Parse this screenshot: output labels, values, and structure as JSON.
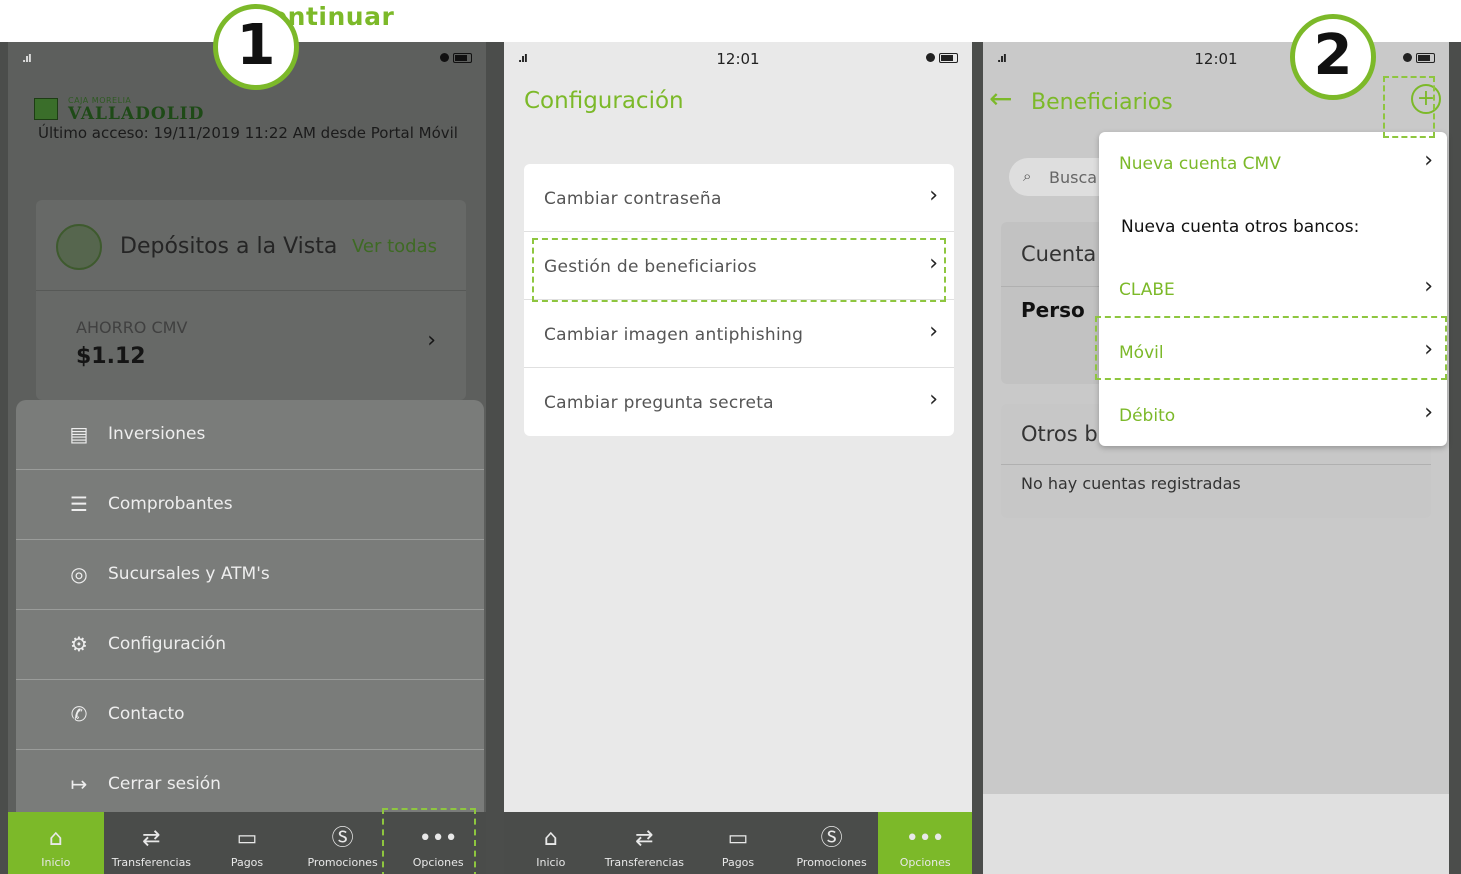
{
  "header_text": "ontinuar",
  "steps": [
    "1",
    "2"
  ],
  "colors": {
    "accent": "#7cb929",
    "nav_bg": "#4a4c4a",
    "screen_bg": "#e9e9e9"
  },
  "panel1": {
    "bank_name_top": "CAJA MORELIA",
    "bank_name": "VALLADOLID",
    "last_access": "Último acceso: 19/11/2019 11:22 AM desde Portal Móvil",
    "account_section_title": "Depósitos a la Vista",
    "view_all": "Ver todas",
    "account_name": "AHORRO CMV",
    "account_balance": "$1.12",
    "menu": [
      {
        "icon": "document-icon",
        "label": "Inversiones"
      },
      {
        "icon": "receipt-icon",
        "label": "Comprobantes"
      },
      {
        "icon": "location-pin-icon",
        "label": "Sucursales y ATM's"
      },
      {
        "icon": "gear-icon",
        "label": "Configuración"
      },
      {
        "icon": "phone-icon",
        "label": "Contacto"
      },
      {
        "icon": "logout-icon",
        "label": "Cerrar sesión"
      }
    ]
  },
  "panel2": {
    "time": "12:01",
    "title": "Configuración",
    "items": [
      {
        "label": "Cambiar contraseña"
      },
      {
        "label": "Gestión de beneficiarios"
      },
      {
        "label": "Cambiar imagen antiphishing"
      },
      {
        "label": "Cambiar pregunta secreta"
      }
    ]
  },
  "nav": [
    {
      "icon": "home-icon",
      "label": "Inicio"
    },
    {
      "icon": "transfer-icon",
      "label": "Transferencias"
    },
    {
      "icon": "payments-icon",
      "label": "Pagos"
    },
    {
      "icon": "dollar-icon",
      "label": "Promociones"
    },
    {
      "icon": "more-icon",
      "label": "Opciones"
    }
  ],
  "panel3": {
    "time": "12:01",
    "title": "Beneficiarios",
    "search_placeholder": "Busca",
    "section1_title": "Cuenta",
    "section1_subtitle": "Perso",
    "section2_title": "Otros b",
    "empty_text": "No hay cuentas registradas",
    "dropdown": [
      {
        "label": "Nueva cuenta CMV",
        "green": true,
        "chevron": true
      },
      {
        "label": "Nueva cuenta otros bancos:",
        "green": false,
        "chevron": false
      },
      {
        "label": "CLABE",
        "green": true,
        "chevron": true
      },
      {
        "label": "Móvil",
        "green": true,
        "chevron": true
      },
      {
        "label": "Débito",
        "green": true,
        "chevron": true
      }
    ]
  }
}
